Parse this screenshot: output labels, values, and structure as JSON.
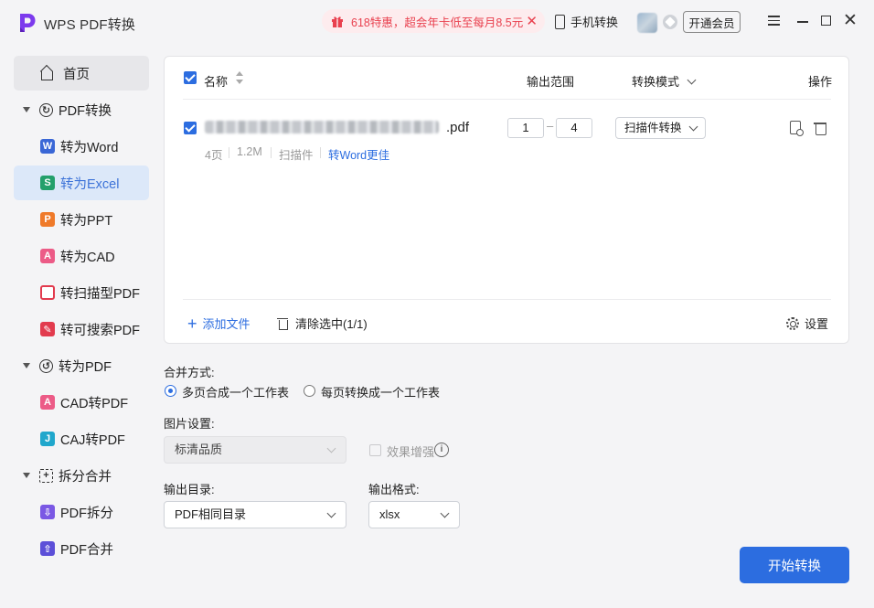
{
  "app": {
    "title": "WPS PDF转换",
    "promo": "618特惠，超会年卡低至每月8.5元",
    "mobile_convert": "手机转换",
    "open_vip": "开通会员",
    "brand_color": "#7c3aed",
    "accent_color": "#2c6de0"
  },
  "sidebar": {
    "home": "首页",
    "pdf_convert": "PDF转换",
    "to_word": "转为Word",
    "to_excel": "转为Excel",
    "to_ppt": "转为PPT",
    "to_cad": "转为CAD",
    "to_scan_pdf": "转扫描型PDF",
    "to_searchable_pdf": "转可搜索PDF",
    "to_pdf": "转为PDF",
    "cad_to_pdf": "CAD转PDF",
    "caj_to_pdf": "CAJ转PDF",
    "split_merge": "拆分合并",
    "pdf_split": "PDF拆分",
    "pdf_merge": "PDF合并",
    "icons": {
      "word": "W",
      "excel": "S",
      "ppt": "P",
      "cad": "A",
      "caj": "J"
    }
  },
  "file_panel": {
    "col_name": "名称",
    "col_range": "输出范围",
    "col_mode": "转换模式",
    "col_action": "操作",
    "file": {
      "ext": ".pdf",
      "pages": "4页",
      "size": "1.2M",
      "type": "扫描件",
      "hint": "转Word更佳",
      "range_from": "1",
      "range_to": "4",
      "range_sep": "–",
      "mode": "扫描件转换"
    },
    "add_file": "添加文件",
    "clear_selected": "清除选中(1/1)",
    "settings": "设置"
  },
  "options": {
    "merge_label": "合并方式:",
    "merge_option1": "多页合成一个工作表",
    "merge_option2": "每页转换成一个工作表",
    "image_label": "图片设置:",
    "image_quality": "标清品质",
    "enhance": "效果增强",
    "info_glyph": "i",
    "output_dir_label": "输出目录:",
    "output_dir": "PDF相同目录",
    "output_format_label": "输出格式:",
    "output_format": "xlsx"
  },
  "start_button": "开始转换"
}
